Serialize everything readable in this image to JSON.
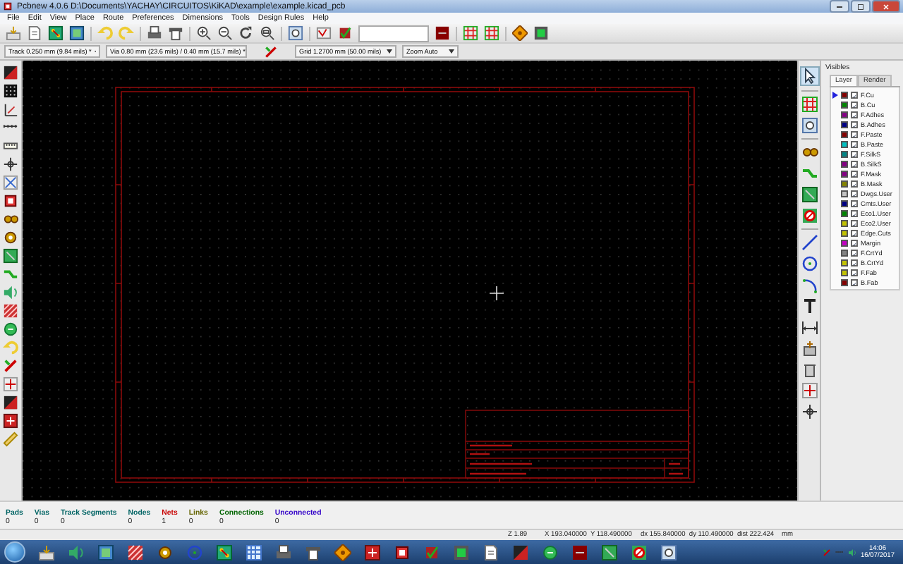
{
  "window": {
    "title": "Pcbnew 4.0.6 D:\\Documents\\YACHAY\\CIRCUITOS\\KiKAD\\example\\example.kicad_pcb"
  },
  "menu": [
    "File",
    "Edit",
    "View",
    "Place",
    "Route",
    "Preferences",
    "Dimensions",
    "Tools",
    "Design Rules",
    "Help"
  ],
  "selectors": [
    "Track 0.250 mm (9.84 mils) *",
    "Via 0.80 mm (23.6 mils) / 0.40 mm (15.7 mils) *",
    "Grid 1.2700 mm (50.00 mils)",
    "Zoom Auto"
  ],
  "layers_panel": {
    "title": "Visibles",
    "tabs": [
      {
        "label": "Layer",
        "selected": true
      },
      {
        "label": "Render",
        "selected": false
      }
    ],
    "layers": [
      {
        "name": "F.Cu",
        "color": "#840000",
        "visible": true,
        "selected": true
      },
      {
        "name": "B.Cu",
        "color": "#008400",
        "visible": true,
        "selected": false
      },
      {
        "name": "F.Adhes",
        "color": "#840084",
        "visible": true,
        "selected": false
      },
      {
        "name": "B.Adhes",
        "color": "#000084",
        "visible": true,
        "selected": false
      },
      {
        "name": "F.Paste",
        "color": "#840000",
        "visible": true,
        "selected": false
      },
      {
        "name": "B.Paste",
        "color": "#00c2c2",
        "visible": true,
        "selected": false
      },
      {
        "name": "F.SilkS",
        "color": "#008484",
        "visible": true,
        "selected": false
      },
      {
        "name": "B.SilkS",
        "color": "#840084",
        "visible": true,
        "selected": false
      },
      {
        "name": "F.Mask",
        "color": "#840084",
        "visible": true,
        "selected": false
      },
      {
        "name": "B.Mask",
        "color": "#848400",
        "visible": true,
        "selected": false
      },
      {
        "name": "Dwgs.User",
        "color": "#c2c2c2",
        "visible": true,
        "selected": false
      },
      {
        "name": "Cmts.User",
        "color": "#000084",
        "visible": true,
        "selected": false
      },
      {
        "name": "Eco1.User",
        "color": "#008400",
        "visible": true,
        "selected": false
      },
      {
        "name": "Eco2.User",
        "color": "#c2c200",
        "visible": true,
        "selected": false
      },
      {
        "name": "Edge.Cuts",
        "color": "#c2c200",
        "visible": true,
        "selected": false
      },
      {
        "name": "Margin",
        "color": "#c200c2",
        "visible": true,
        "selected": false
      },
      {
        "name": "F.CrtYd",
        "color": "#848484",
        "visible": true,
        "selected": false
      },
      {
        "name": "B.CrtYd",
        "color": "#c2c200",
        "visible": true,
        "selected": false
      },
      {
        "name": "F.Fab",
        "color": "#c2c200",
        "visible": true,
        "selected": false
      },
      {
        "name": "B.Fab",
        "color": "#840000",
        "visible": true,
        "selected": false
      }
    ]
  },
  "message_panel": [
    {
      "label": "Pads",
      "value": "0",
      "color": "#006464"
    },
    {
      "label": "Vias",
      "value": "0",
      "color": "#006464"
    },
    {
      "label": "Track Segments",
      "value": "0",
      "color": "#006464"
    },
    {
      "label": "Nodes",
      "value": "0",
      "color": "#006464"
    },
    {
      "label": "Nets",
      "value": "1",
      "color": "#c80000"
    },
    {
      "label": "Links",
      "value": "0",
      "color": "#646400"
    },
    {
      "label": "Connections",
      "value": "0",
      "color": "#006400"
    },
    {
      "label": "Unconnected",
      "value": "0",
      "color": "#3200c8"
    }
  ],
  "status_bar": {
    "zoom": "Z 1.89",
    "position": "X 193.040000  Y 118.490000",
    "delta": "dx 155.840000  dy 110.490000  dist 222.424",
    "units": "mm"
  },
  "taskbar": {
    "time": "14:06",
    "date": "16/07/2017"
  }
}
